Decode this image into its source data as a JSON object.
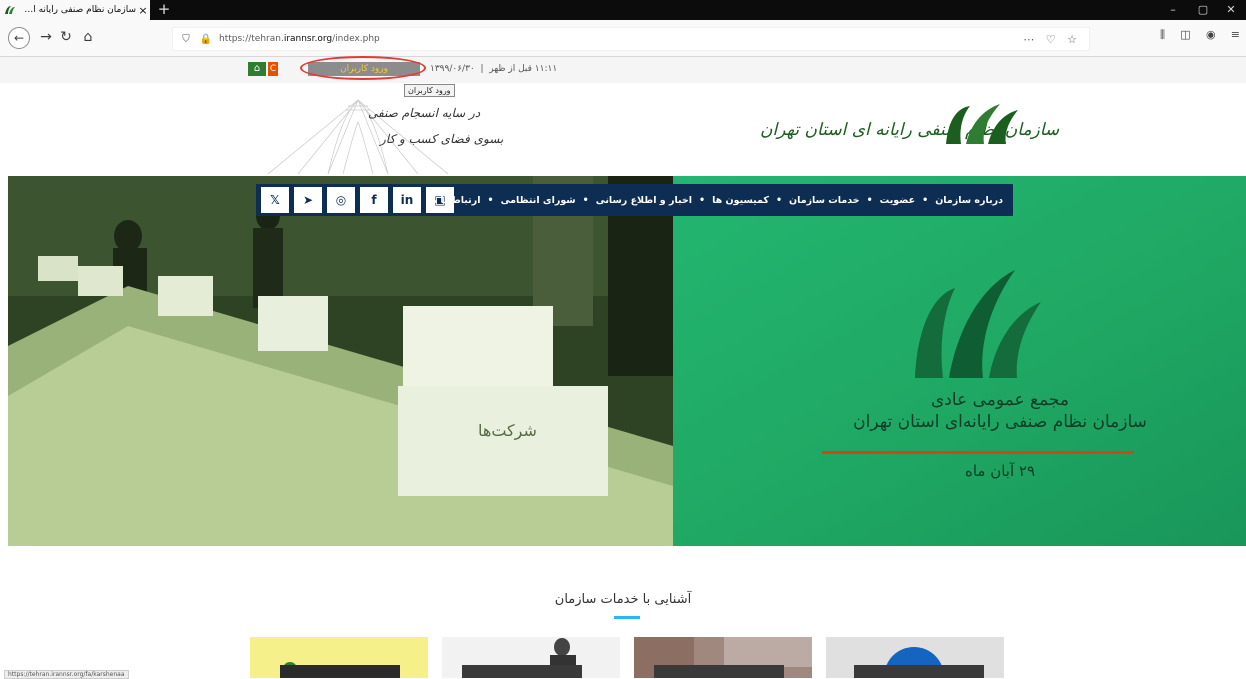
{
  "browser": {
    "tab_title": "سازمان نظام صنفی رایانه ای تهران",
    "tab_close": "×",
    "new_tab": "+",
    "window_controls": [
      "–",
      "▢",
      "✕"
    ],
    "url_prefix": "https://tehran.",
    "url_domain": "irannsr.org",
    "url_path": "/index.php",
    "url_right_icons": "⋯ ♡ ☆",
    "toolbar_icons": [
      "⫼",
      "◫",
      "◉",
      "≡"
    ],
    "status_url": "https://tehran.irannsr.org/fa/karshenaa"
  },
  "site": {
    "home_icon": "home-icon",
    "lang_icon": "C",
    "login_label": "ورود کاربران",
    "login_tooltip": "ورود کاربران",
    "time": "۱۱:۱۱ قبل از ظهر",
    "date": "۱۳۹۹/۰۶/۳۰",
    "slogan_line1": "در سایه انسجام صنفی",
    "slogan_line2": "بسوی فضای کسب و کار",
    "org_name": "سازمان نظام صنفی رایانه ای استان تهران"
  },
  "nav": {
    "social": [
      "twitter-icon",
      "telegram-icon",
      "instagram-icon",
      "facebook-icon",
      "linkedin-icon",
      "aparat-icon"
    ],
    "social_glyphs": [
      "𝕏",
      "➤",
      "◎",
      "f",
      "in",
      "▣"
    ],
    "items": [
      "درباره سازمان",
      "عضویت",
      "خدمات سازمان",
      "کمیسیون ها",
      "اخبار و اطلاع رسانی",
      "شورای انتظامی",
      "ارتباط با ما"
    ],
    "separator": "•"
  },
  "hero": {
    "line1": "مجمع عمومی عادی",
    "line2": "سازمان نظام صنفی رایانه‌ای استان تهران",
    "line3": "۲۹ آبان ماه",
    "photo_text_box": "شرکت‌ها",
    "colors": {
      "green": "#1fa863",
      "navy": "#0e2d53",
      "accent_red": "#d84315"
    }
  },
  "section": {
    "title": "آشنایی با خدمات سازمان"
  }
}
